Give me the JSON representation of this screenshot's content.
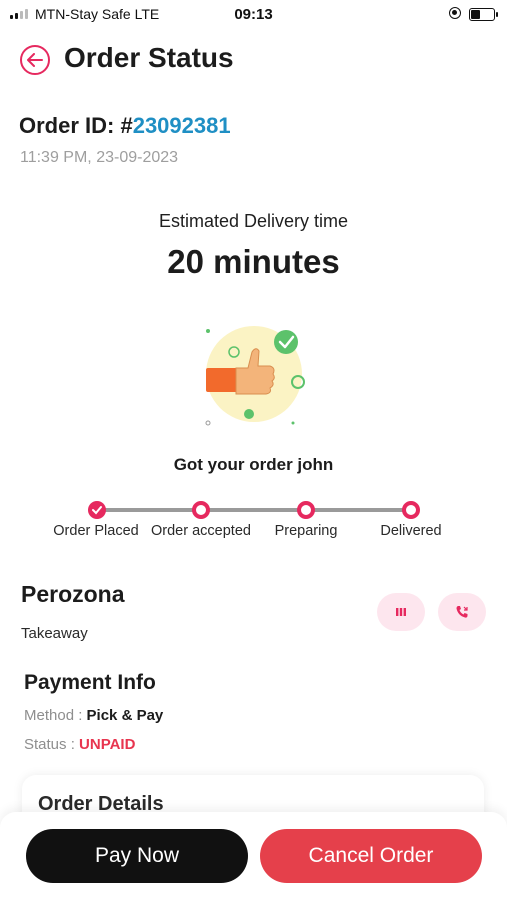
{
  "status_bar": {
    "carrier": "MTN-Stay Safe  LTE",
    "time": "09:13"
  },
  "header": {
    "title": "Order Status",
    "back_icon": "arrow-left-icon"
  },
  "order": {
    "id_label": "Order ID: #",
    "id_number": "23092381",
    "timestamp": "11:39 PM, 23-09-2023"
  },
  "delivery": {
    "label": "Estimated Delivery time",
    "value": "20 minutes"
  },
  "greeting": "Got your order john",
  "steps": [
    {
      "label": "Order Placed",
      "state": "done"
    },
    {
      "label": "Order accepted",
      "state": "pending"
    },
    {
      "label": "Preparing",
      "state": "pending"
    },
    {
      "label": "Delivered",
      "state": "pending"
    }
  ],
  "restaurant": {
    "name": "Perozona",
    "type": "Takeaway",
    "actions": [
      "menu-icon",
      "phone-icon"
    ]
  },
  "payment": {
    "title": "Payment Info",
    "method_key": "Method : ",
    "method_value": "Pick & Pay",
    "status_key": "Status : ",
    "status_value": "UNPAID"
  },
  "details": {
    "title": "Order Details"
  },
  "actions": {
    "pay_now": "Pay Now",
    "cancel_order": "Cancel Order"
  },
  "colors": {
    "accent": "#e6295f",
    "order_id": "#1f8fc4",
    "unpaid": "#e8354f",
    "cancel": "#e5404b",
    "pay": "#111111"
  }
}
